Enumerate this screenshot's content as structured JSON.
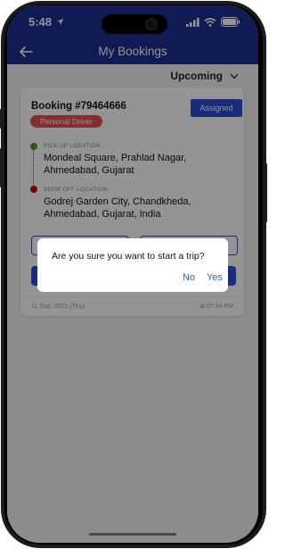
{
  "status_bar": {
    "time": "5:48"
  },
  "header": {
    "title": "My Bookings",
    "back_icon": "arrow-left-icon"
  },
  "filter": {
    "selected": "Upcoming"
  },
  "booking": {
    "id_label": "Booking #79464666",
    "status": "Assigned",
    "driver_type": "Personal Driver",
    "pickup_label": "PICK UP LOCATION",
    "pickup_address": "Mondeal Square, Prahlad Nagar, Ahmedabad, Gujarat",
    "dropoff_label": "DROP OFF LOCATION",
    "dropoff_address": "Godrej Garden City, Chandkheda, Ahmedabad, Gujarat, India",
    "date": "11 Sep, 2025 (Thu)",
    "time": "at 07:44 PM"
  },
  "dialog": {
    "message": "Are you sure you want to start a trip?",
    "no_label": "No",
    "yes_label": "Yes"
  },
  "colors": {
    "header_bg": "#1c2e8f",
    "accent": "#2e4bd6",
    "driver_badge": "#e35151",
    "pickup_dot": "#5a9a1f",
    "dropoff_dot": "#b3141c",
    "dialog_action": "#3a5bd9"
  }
}
